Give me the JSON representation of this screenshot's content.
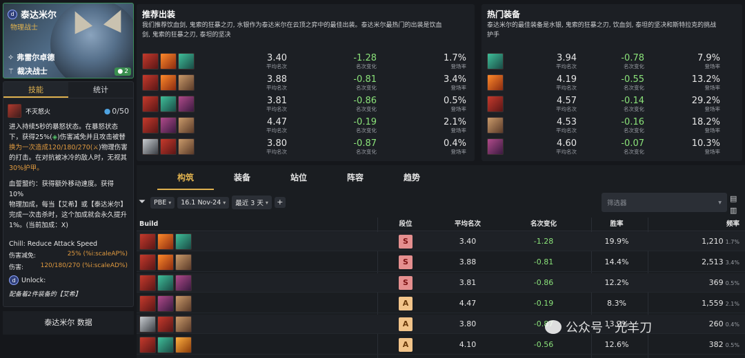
{
  "hero": {
    "name": "泰达米尔",
    "class": "物理战士",
    "traits": [
      "弗雷尔卓德",
      "裁决战士"
    ],
    "cost": "2",
    "tabs": [
      "技能",
      "统计"
    ],
    "ability_name": "不灭怒火",
    "mana": "0/50",
    "desc_lines": [
      "进入持续5秒的暴怒状态。在暴怒状态",
      "下，获得25%(",
      ")伤害减免并且攻击被替",
      "换为一次造成120/180/270(",
      ")物理伤害",
      "的打击。在对抗被冰冷的敌人时，无视其",
      "30%护甲。"
    ],
    "desc2_lines": [
      "血誓盟约：获得额外移动速度。获得10%",
      "物理加成，每当【艾希】或【泰达米尔】",
      "完成一次击杀时，这个加成就会永久提升",
      "1%。(当前加成：X)"
    ],
    "chill": "Chill: Reduce Attack Speed",
    "stat1_label": "伤害减免:",
    "stat1_value": "25% (%i:scaleAP%)",
    "stat2_label": "伤害:",
    "stat2_value": "120/180/270 (%i:scaleAD%)",
    "unlock_label": "Unlock:",
    "unlock_note": "配备着2件装备的【艾希】",
    "data_button": "泰达米尔 数据"
  },
  "recommended": {
    "title": "推荐出装",
    "desc_line1": "我们推荐饮血剑, 鬼索的狂暴之刃, 水银作为泰达米尔在云顶之弈中的最佳出装。泰达米尔最热门的出装是饮血",
    "desc_line2": "剑, 鬼索的狂暴之刃, 泰坦的坚决",
    "avg_label": "平均名次",
    "delta_label": "名次变化",
    "rate_label": "登场率",
    "rows": [
      {
        "items": [
          "red",
          "flame",
          "teal"
        ],
        "avg": "3.40",
        "delta": "-1.28",
        "rate": "1.7%"
      },
      {
        "items": [
          "red",
          "flame",
          "bronze"
        ],
        "avg": "3.88",
        "delta": "-0.81",
        "rate": "3.4%"
      },
      {
        "items": [
          "red",
          "teal",
          "purple"
        ],
        "avg": "3.81",
        "delta": "-0.86",
        "rate": "0.5%"
      },
      {
        "items": [
          "red",
          "purple",
          "bronze"
        ],
        "avg": "4.47",
        "delta": "-0.19",
        "rate": "2.1%"
      },
      {
        "items": [
          "steel",
          "red",
          "bronze"
        ],
        "avg": "3.80",
        "delta": "-0.87",
        "rate": "0.4%"
      }
    ]
  },
  "popular": {
    "title": "热门装备",
    "desc_line1": "泰达米尔的最佳装备是水银, 鬼索的狂暴之刃, 饮血剑, 泰坦的坚决和斯特拉克的挑战",
    "desc_line2": "护手",
    "rows": [
      {
        "item": "teal",
        "avg": "3.94",
        "delta": "-0.78",
        "rate": "7.9%"
      },
      {
        "item": "flame",
        "avg": "4.19",
        "delta": "-0.55",
        "rate": "13.2%"
      },
      {
        "item": "red",
        "avg": "4.57",
        "delta": "-0.14",
        "rate": "29.2%"
      },
      {
        "item": "bronze",
        "avg": "4.53",
        "delta": "-0.16",
        "rate": "18.2%"
      },
      {
        "item": "purple",
        "avg": "4.60",
        "delta": "-0.07",
        "rate": "10.3%"
      }
    ]
  },
  "tabs": [
    "构筑",
    "装备",
    "站位",
    "阵容",
    "趋势"
  ],
  "filters": {
    "server": "PBE",
    "patch": "16.1 Nov-24",
    "range": "最近 3 天",
    "placeholder": "筛选器"
  },
  "table": {
    "headers": [
      "Build",
      "段位",
      "平均名次",
      "名次变化",
      "胜率",
      "频率"
    ],
    "rows": [
      {
        "items": [
          "red",
          "flame",
          "teal"
        ],
        "tier": "S",
        "avg": "3.40",
        "delta": "-1.28",
        "win": "19.9%",
        "freq": "1,210",
        "pct": "1.7%"
      },
      {
        "items": [
          "red",
          "flame",
          "bronze"
        ],
        "tier": "S",
        "avg": "3.88",
        "delta": "-0.81",
        "win": "14.4%",
        "freq": "2,513",
        "pct": "3.4%"
      },
      {
        "items": [
          "red",
          "teal",
          "purple"
        ],
        "tier": "S",
        "avg": "3.81",
        "delta": "-0.86",
        "win": "12.2%",
        "freq": "369",
        "pct": "0.5%"
      },
      {
        "items": [
          "red",
          "purple",
          "bronze"
        ],
        "tier": "A",
        "avg": "4.47",
        "delta": "-0.19",
        "win": "8.3%",
        "freq": "1,559",
        "pct": "2.1%"
      },
      {
        "items": [
          "steel",
          "red",
          "bronze"
        ],
        "tier": "A",
        "avg": "3.80",
        "delta": "-0.87",
        "win": "13.2%",
        "freq": "260",
        "pct": "0.4%"
      },
      {
        "items": [
          "red",
          "teal",
          "gold"
        ],
        "tier": "A",
        "avg": "4.10",
        "delta": "-0.56",
        "win": "12.6%",
        "freq": "382",
        "pct": "0.5%"
      }
    ]
  },
  "watermark": "公众号 · 光羊刀"
}
